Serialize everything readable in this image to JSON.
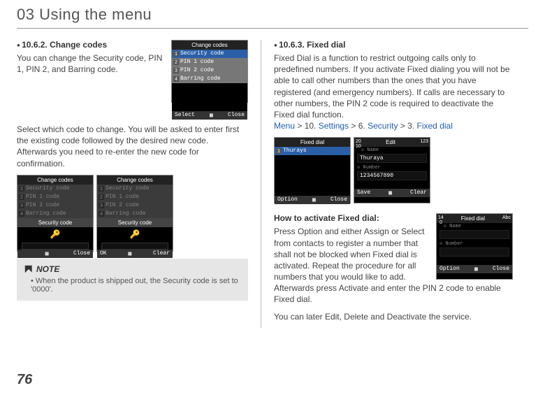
{
  "chapter": {
    "title": "03 Using the menu"
  },
  "page_number": "76",
  "left": {
    "section_head": "10.6.2. Change codes",
    "intro": "You can change the Security code, PIN 1, PIN 2, and Barring code.",
    "para2": "Select which code to change. You will be asked to enter first the existing code followed by the desired new code. Afterwards you need to re-enter the new code for confirmation.",
    "note_title": "NOTE",
    "note_body": "When the product is shipped out, the Security code is set to '0000'.",
    "shot1": {
      "title": "Change codes",
      "items": [
        "Security code",
        "PIN 1 code",
        "PIN 2 code",
        "Barring code"
      ],
      "soft_left": "Select",
      "soft_right": "Close"
    },
    "shot2": {
      "title": "Change codes",
      "items": [
        "Security code",
        "PIN 1 code",
        "PIN 2 code",
        "Barring code"
      ],
      "sub": "Security code",
      "soft_left": "",
      "soft_right": "Close"
    },
    "shot3": {
      "title": "Change codes",
      "items": [
        "Security code",
        "PIN 1 code",
        "PIN 2 code",
        "Barring code"
      ],
      "sub": "Security code",
      "soft_left": "OK",
      "soft_right": "Clear"
    }
  },
  "right": {
    "section_head": "10.6.3. Fixed dial",
    "intro": "Fixed Dial is a function to restrict outgoing calls only to predefined numbers. If you activate Fixed dialing you will not be able to call other numbers than the ones that you have registered (and emergency numbers). If calls are necessary to other numbers, the PIN 2 code is required to deactivate the Fixed dial function.",
    "path": {
      "menu": "Menu",
      "g1": " > 10. ",
      "settings": "Settings",
      "g2": " > 6. ",
      "security": "Security",
      "g3": " > 3. ",
      "fixed": "Fixed dial"
    },
    "shotA": {
      "title": "Fixed dial",
      "item": "Thurays",
      "soft_left": "Option",
      "soft_right": "Close"
    },
    "shotB": {
      "title": "Edit",
      "name_lbl": "Name",
      "name_val": "Thuraya",
      "num_lbl": "Number",
      "num_val": "1234567890",
      "soft_left": "Save",
      "soft_right": "Clear"
    },
    "how_head": "How to activate Fixed dial:",
    "how_body": "Press Option and either Assign or Select from contacts to register a number that shall not be blocked when Fixed dial is activated. Repeat the procedure for all numbers that you would like to add. Afterwards press Activate and enter the PIN 2 code to enable Fixed dial.",
    "how_after": "You can later Edit, Delete and Deactivate the service.",
    "shotC": {
      "title": "Fixed dial",
      "name_lbl": "Name",
      "num_lbl": "Number",
      "soft_left": "Option",
      "soft_right": "Close"
    }
  }
}
